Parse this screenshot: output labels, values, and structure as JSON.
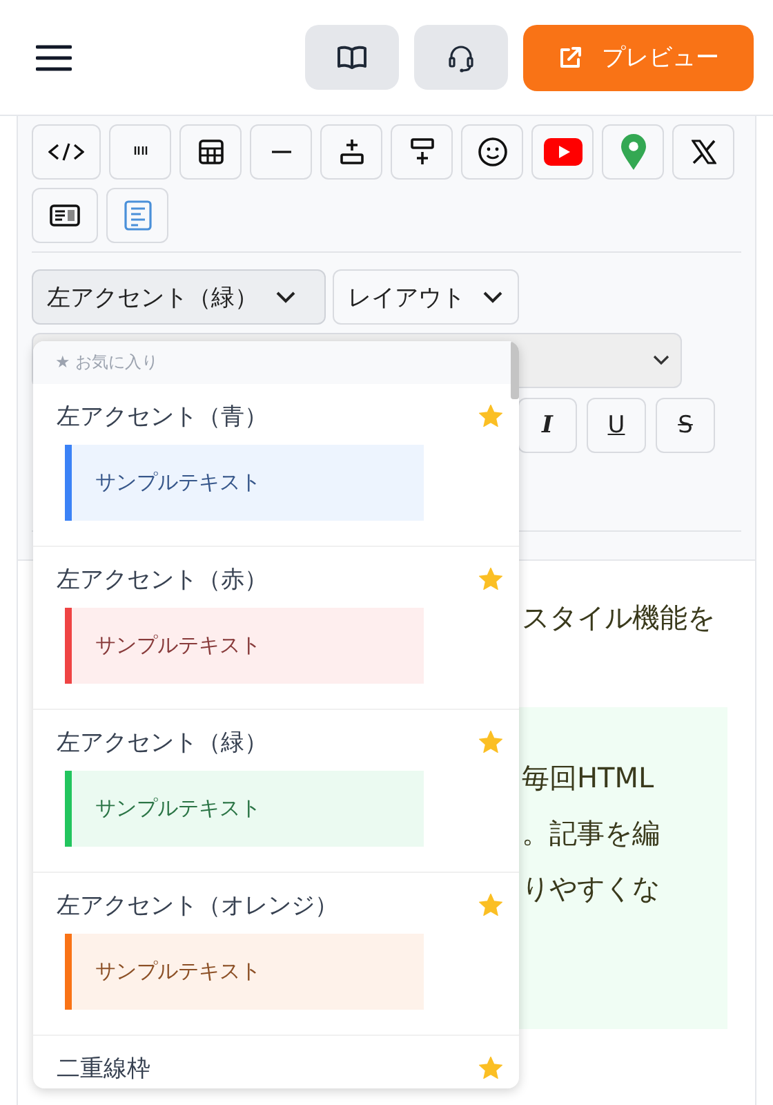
{
  "header": {
    "preview_label": "プレビュー"
  },
  "style_dropdown": {
    "label": "左アクセント（緑）",
    "expanded": true
  },
  "layout_dropdown": {
    "label": "レイアウト"
  },
  "format_buttons": [
    {
      "label": "I",
      "kind": "italic"
    },
    {
      "label": "U",
      "kind": "underline"
    },
    {
      "label": "S",
      "kind": "strike"
    }
  ],
  "style_menu": {
    "section_label": "★ お気に入り",
    "items": [
      {
        "name": "左アクセント（青）",
        "favorite": true,
        "color": "#3b82f6",
        "sample": "サンプルテキスト"
      },
      {
        "name": "左アクセント（赤）",
        "favorite": true,
        "color": "#ef4444",
        "sample": "サンプルテキスト"
      },
      {
        "name": "左アクセント（緑）",
        "favorite": true,
        "color": "#22c55e",
        "sample": "サンプルテキスト"
      },
      {
        "name": "左アクセント（オレンジ）",
        "favorite": true,
        "color": "#f97316",
        "sample": "サンプルテキスト"
      },
      {
        "name": "二重線枠",
        "favorite": true
      }
    ]
  },
  "editor": {
    "paragraph_fragment": "スタイル機能を",
    "box_lines": [
      "毎回HTML",
      "。記事を編",
      "りやすくな"
    ]
  }
}
